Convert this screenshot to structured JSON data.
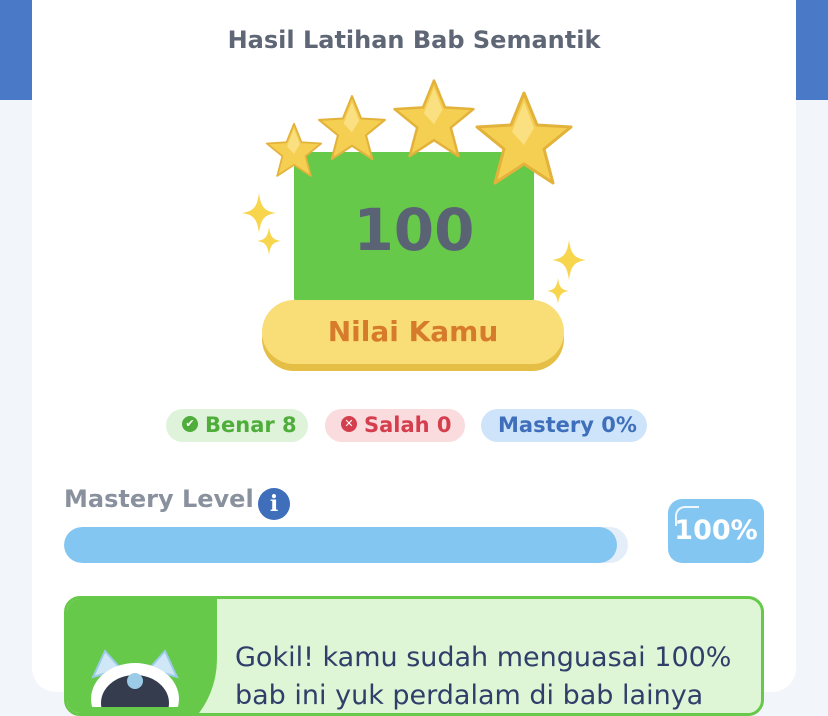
{
  "result": {
    "title": "Hasil Latihan Bab Semantik",
    "score": "100",
    "score_label": "Nilai Kamu",
    "stars_earned": 4,
    "stars_total": 4
  },
  "badges": {
    "correct": "Benar 8",
    "wrong": "Salah 0",
    "mastery": "Mastery 0%"
  },
  "mastery": {
    "label": "Mastery Level",
    "percent_text": "100%",
    "progress_fraction": 0.98
  },
  "message": {
    "text": "Gokil! kamu sudah menguasai 100% bab ini yuk perdalam di bab lainya"
  },
  "icons": {
    "info": "info-icon",
    "check": "check-circle-icon",
    "close": "close-circle-icon",
    "star": "star-icon",
    "sparkle": "sparkle-icon",
    "mascot": "robot-mascot-icon"
  },
  "colors": {
    "brand_blue": "#4a79c8",
    "score_green": "#66c94a",
    "star_gold": "#f5cf52",
    "button_yellow": "#f9dd77",
    "progress_blue": "#84c6f2"
  }
}
